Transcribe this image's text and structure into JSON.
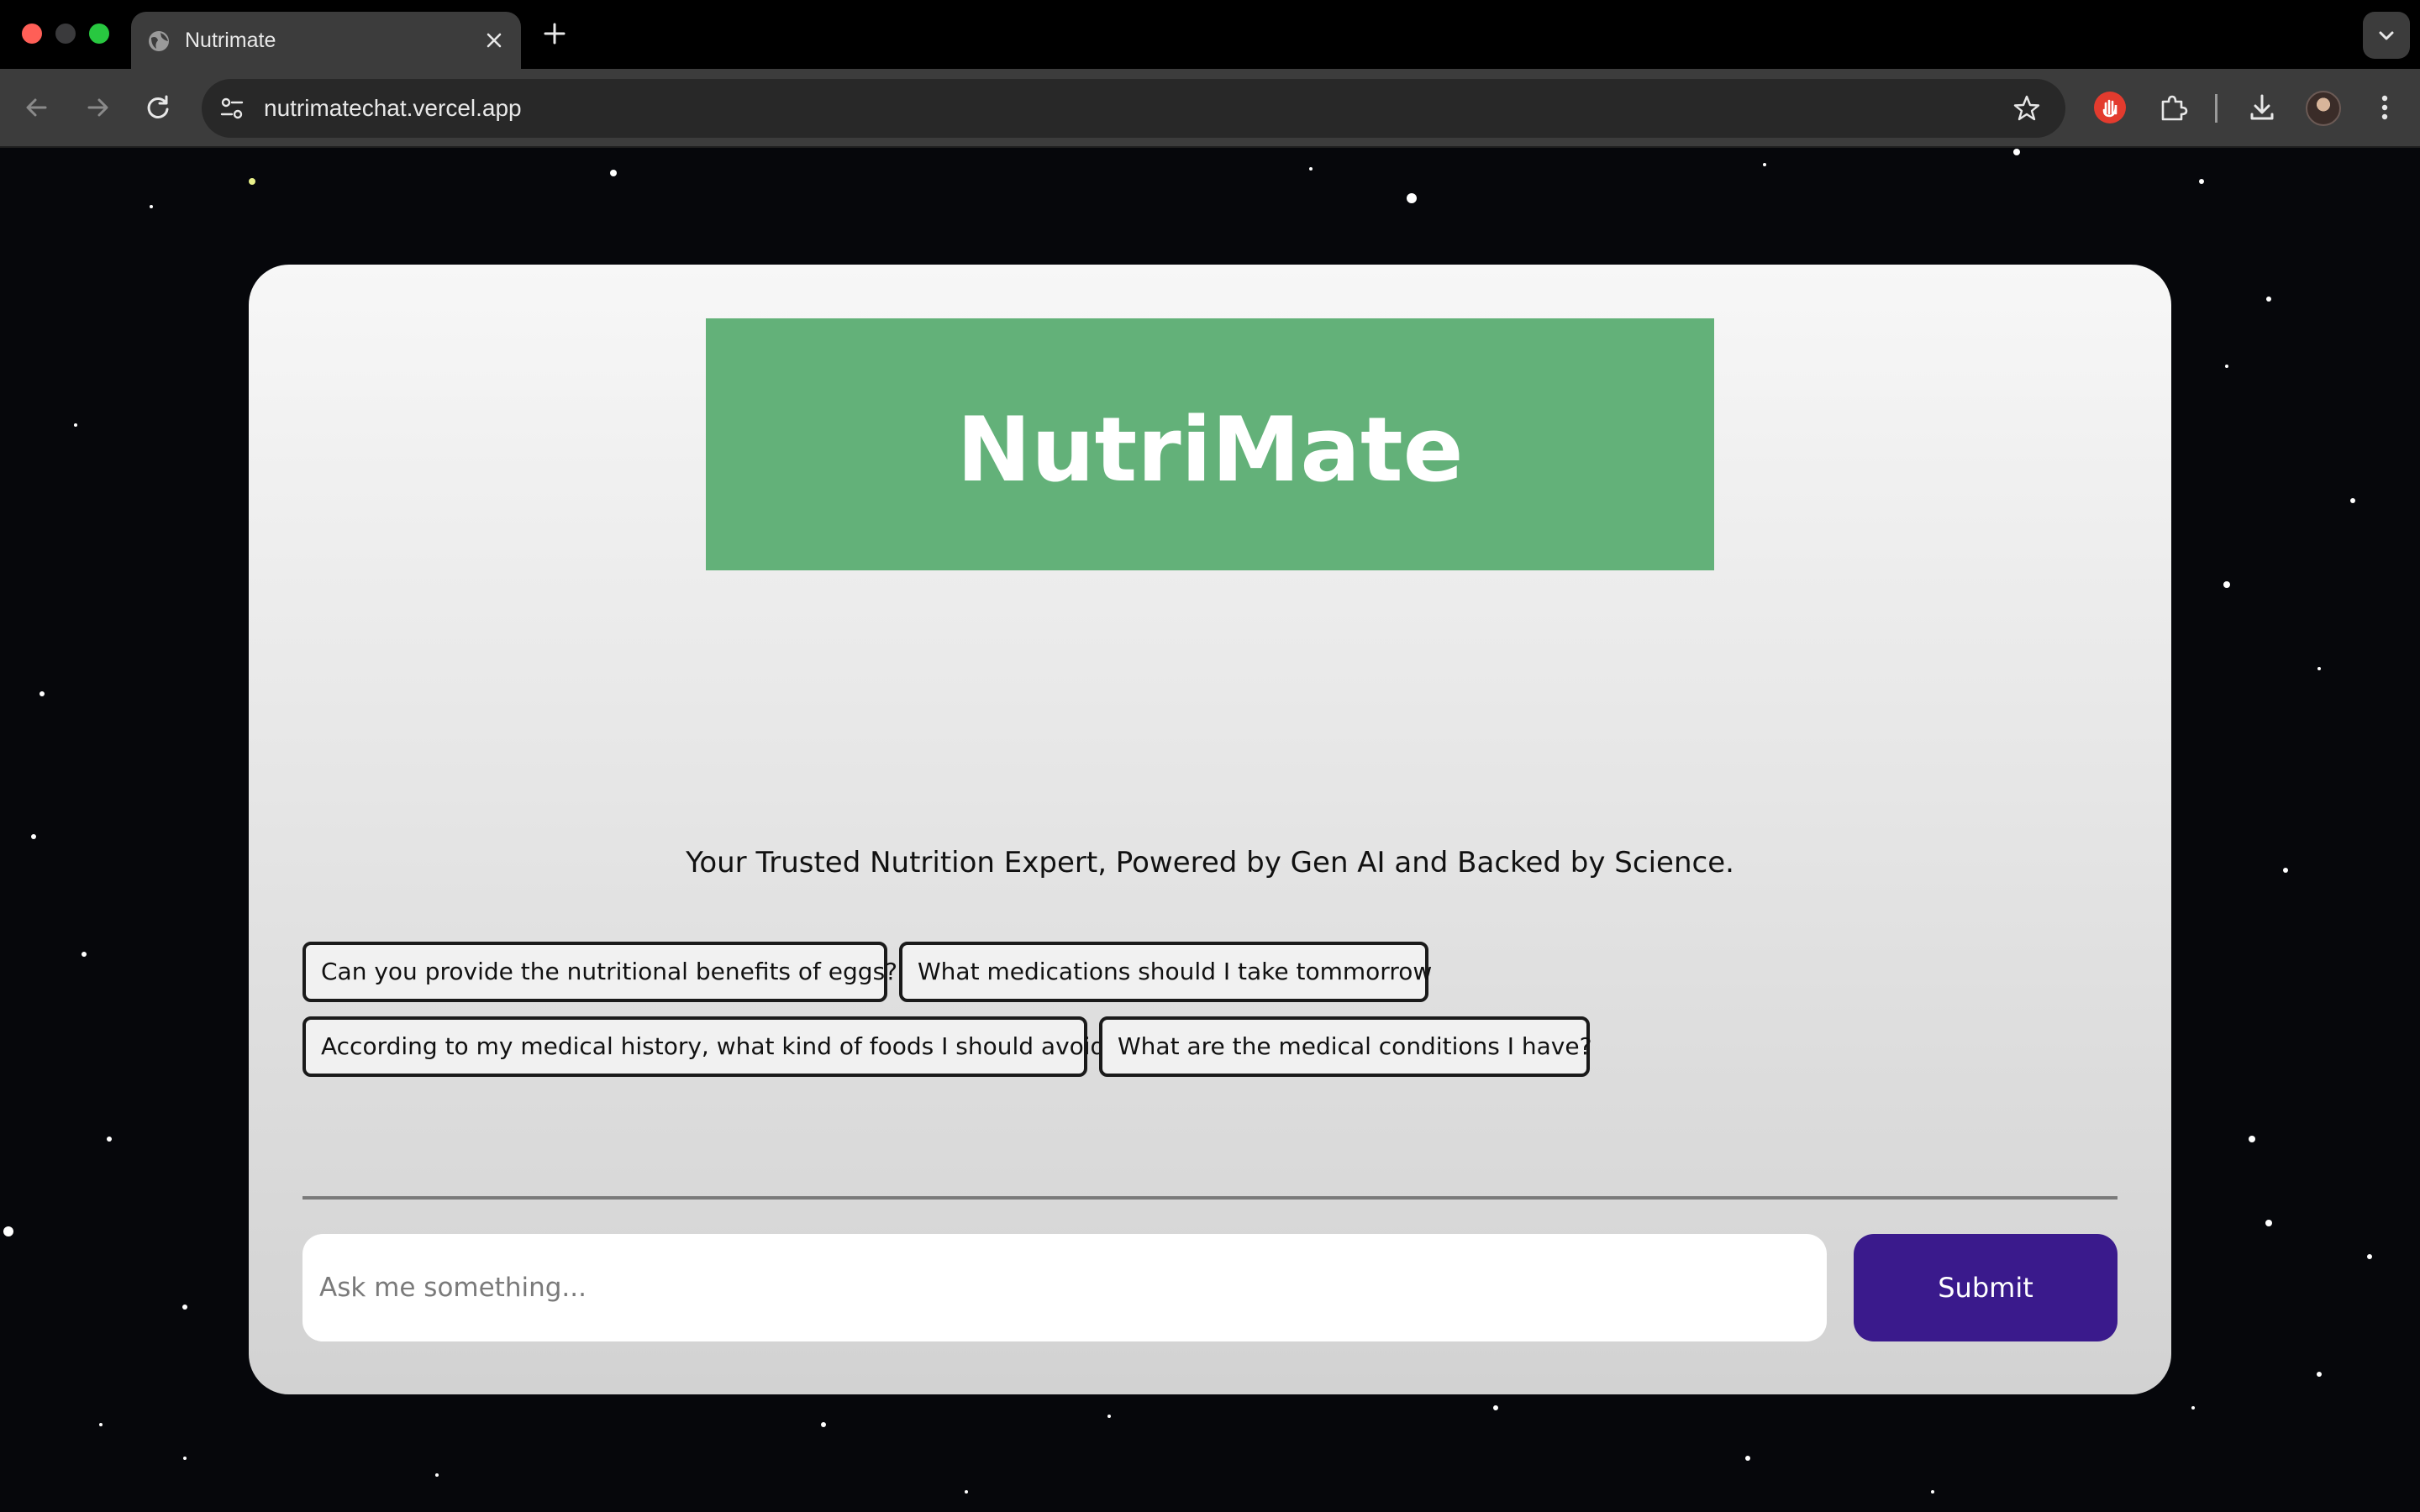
{
  "browser": {
    "tab_title": "Nutrimate",
    "url": "nutrimatechat.vercel.app"
  },
  "page": {
    "logo_text": "NutriMate",
    "tagline": "Your Trusted Nutrition Expert, Powered by Gen AI and Backed by Science.",
    "suggestions": [
      "Can you provide the nutritional benefits of eggs?",
      "What medications should I take tommorrow",
      "According to my medical history, what kind of foods I should avoid",
      "What are the medical conditions I have?"
    ],
    "input_placeholder": "Ask me something...",
    "submit_label": "Submit"
  },
  "colors": {
    "logo_bg": "#63b179",
    "submit_bg": "#3a1a8c",
    "page_bg": "#06070b"
  }
}
